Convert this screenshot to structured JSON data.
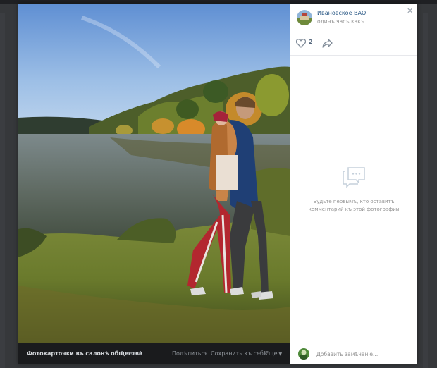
{
  "post": {
    "author": "Ивановское ВАО",
    "time": "одинъ часъ какъ",
    "likes": "2"
  },
  "comments": {
    "empty_line1": "Будьте первымъ, кто оставитъ",
    "empty_line2": "комментарий къ этой фотографии",
    "placeholder": "Добавить замѣчанiе..."
  },
  "photobar": {
    "album": "Фотокарточки въ салонѣ общества",
    "counter": "1 изъ 4",
    "share": "Подѣлиться",
    "save": "Сохранить къ себѣ",
    "more": "Еще"
  },
  "icons": {
    "close": "close-icon",
    "like": "heart-icon",
    "share": "share-arrow-icon",
    "comments": "comment-bubble-icon",
    "more": "chevron-down-icon"
  },
  "colors": {
    "link": "#2a5885",
    "muted": "#939393",
    "bar": "#1a1b1d",
    "page": "#36383b"
  }
}
